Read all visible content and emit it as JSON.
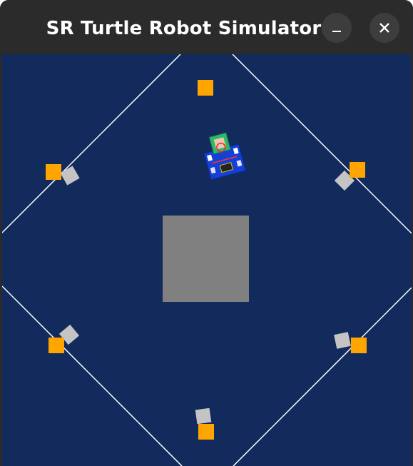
{
  "window": {
    "title": "SR Turtle Robot Simulator",
    "minimize_icon": "minimize-icon",
    "close_icon": "close-icon"
  },
  "colors": {
    "titlebar": "#2b2b2b",
    "arena_background": "#122a5c",
    "arena_lines": "#ffffff",
    "central_block": "#808080",
    "tokens": "#ffa500",
    "token_markers": "#c4c4c4",
    "robot_body": "#1440d6",
    "robot_tray": "#2fb86a"
  }
}
